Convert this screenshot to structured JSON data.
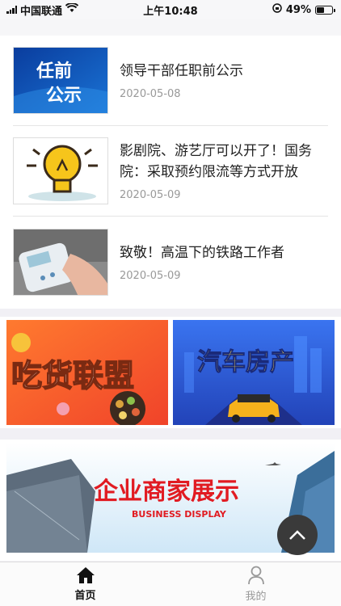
{
  "status_bar": {
    "carrier": "中国联通",
    "time": "上午10:48",
    "battery_percent": "49%",
    "battery_level": 0.49,
    "icons": [
      "signal-icon",
      "wifi-icon",
      "orientation-lock-icon",
      "battery-icon"
    ]
  },
  "news": [
    {
      "title": "领导干部任职前公示",
      "date": "2020-05-08",
      "thumb_text": [
        "任前",
        "公示"
      ]
    },
    {
      "title": "影剧院、游艺厅可以开了！国务院：采取预约限流等方式开放",
      "date": "2020-05-09"
    },
    {
      "title": "致敬！高温下的铁路工作者",
      "date": "2020-05-09"
    }
  ],
  "promos": [
    {
      "text": "吃货联盟"
    },
    {
      "text": "汽车房产"
    }
  ],
  "banner": {
    "title": "企业商家展示",
    "subtitle": "BUSINESS DISPLAY"
  },
  "back_to_top": {
    "icon": "chevron-up-icon"
  },
  "tabbar": [
    {
      "label": "首页",
      "icon": "home-icon",
      "active": true
    },
    {
      "label": "我的",
      "icon": "user-icon",
      "active": false
    }
  ],
  "colors": {
    "promo_left_bg": "#f4552c",
    "promo_right_bg": "#2d5bd8",
    "banner_title": "#e11b22"
  }
}
